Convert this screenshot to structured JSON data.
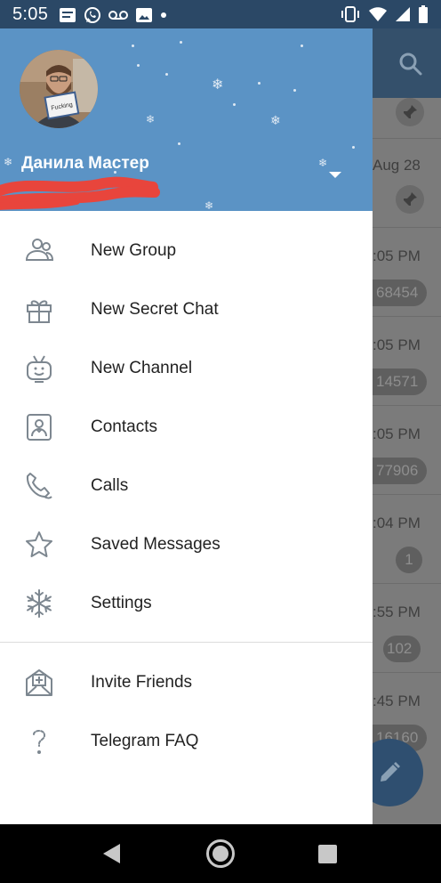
{
  "status_bar": {
    "time": "5:05"
  },
  "user": {
    "name": "Данила Мастер",
    "avatar_sign_text": "Fucking"
  },
  "menu": {
    "items": [
      {
        "label": "New Group",
        "icon": "new-group-icon"
      },
      {
        "label": "New Secret Chat",
        "icon": "gift-icon"
      },
      {
        "label": "New Channel",
        "icon": "tv-icon"
      },
      {
        "label": "Contacts",
        "icon": "contacts-icon"
      },
      {
        "label": "Calls",
        "icon": "phone-icon"
      },
      {
        "label": "Saved Messages",
        "icon": "star-icon"
      },
      {
        "label": "Settings",
        "icon": "snowflake-icon"
      }
    ],
    "secondary_items": [
      {
        "label": "Invite Friends",
        "icon": "invite-envelope-icon"
      },
      {
        "label": "Telegram FAQ",
        "icon": "question-icon"
      }
    ]
  },
  "chat_list_behind": {
    "rows": [
      {
        "time": "",
        "badge": "",
        "pinned": true
      },
      {
        "time": "Aug 28",
        "badge": "",
        "pinned": true
      },
      {
        "time": ":05 PM",
        "badge": "68454",
        "pinned": false
      },
      {
        "time": ":05 PM",
        "badge": "14571",
        "pinned": false
      },
      {
        "time": ":05 PM",
        "badge": "77906",
        "pinned": false
      },
      {
        "time": ":04 PM",
        "badge": "1",
        "pinned": false
      },
      {
        "time": ":55 PM",
        "badge": "102",
        "pinned": false
      },
      {
        "time": ":45 PM",
        "badge": "16160",
        "pinned": false
      }
    ]
  },
  "colors": {
    "drawer_header": "#5b93c5",
    "status_bar": "#2b4866",
    "app_bar": "#34506b",
    "redaction_scribble": "#e8453c"
  }
}
